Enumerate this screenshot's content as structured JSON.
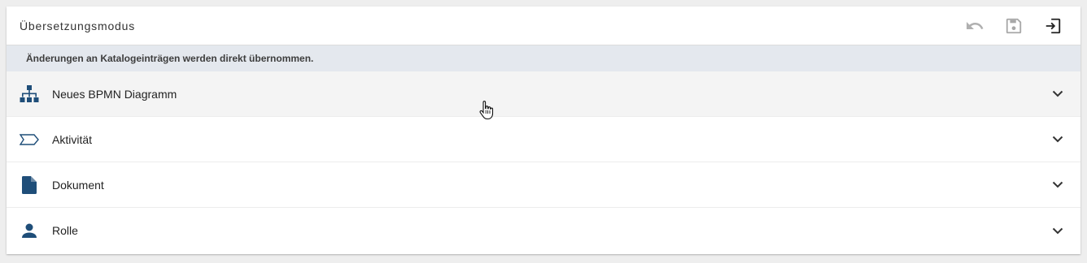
{
  "header": {
    "title": "Übersetzungsmodus",
    "actions": [
      {
        "name": "undo-icon",
        "color": "#b0b0b0"
      },
      {
        "name": "save-icon",
        "color": "#b0b0b0"
      },
      {
        "name": "exit-icon",
        "color": "#222222"
      }
    ]
  },
  "info": {
    "text": "Änderungen an Katalogeinträgen werden direkt übernommen."
  },
  "items": [
    {
      "label": "Neues BPMN Diagramm",
      "icon": "hierarchy-icon"
    },
    {
      "label": "Aktivität",
      "icon": "activity-shape-icon"
    },
    {
      "label": "Dokument",
      "icon": "document-icon"
    },
    {
      "label": "Rolle",
      "icon": "person-icon"
    }
  ],
  "colors": {
    "accent": "#1f4e79",
    "info_bg": "#e4e8ee",
    "hover_bg": "#f4f4f4"
  }
}
